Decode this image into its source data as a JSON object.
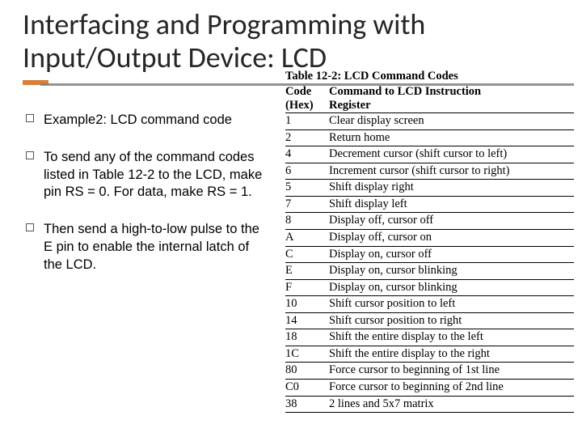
{
  "title": "Interfacing and Programming with Input/Output Device: LCD",
  "bullets": [
    "Example2: LCD command code",
    "To send any of the command codes listed in Table 12-2 to the LCD, make pin RS = 0. For data, make RS = 1.",
    "Then send a high-to-low pulse to the E pin to enable the internal latch of the LCD."
  ],
  "table": {
    "caption": "Table 12-2: LCD Command Codes",
    "head_code": "Code",
    "head_cmd": "Command to LCD Instruction",
    "sub_code": "(Hex)",
    "sub_cmd": "Register",
    "rows": [
      [
        "1",
        "Clear display screen"
      ],
      [
        "2",
        "Return home"
      ],
      [
        "4",
        "Decrement cursor (shift cursor to left)"
      ],
      [
        "6",
        "Increment cursor (shift cursor to right)"
      ],
      [
        "5",
        "Shift display right"
      ],
      [
        "7",
        "Shift display left"
      ],
      [
        "8",
        "Display off, cursor off"
      ],
      [
        "A",
        "Display off, cursor on"
      ],
      [
        "C",
        "Display on, cursor off"
      ],
      [
        "E",
        "Display on, cursor blinking"
      ],
      [
        "F",
        "Display on, cursor blinking"
      ],
      [
        "10",
        "Shift cursor position to left"
      ],
      [
        "14",
        "Shift cursor position to right"
      ],
      [
        "18",
        "Shift the entire display to the left"
      ],
      [
        "1C",
        "Shift the entire display to the right"
      ],
      [
        "80",
        "Force cursor to beginning of 1st line"
      ],
      [
        "C0",
        "Force cursor to beginning of 2nd line"
      ],
      [
        "38",
        "2 lines and 5x7 matrix"
      ]
    ]
  },
  "chart_data": {
    "type": "table",
    "title": "Table 12-2: LCD Command Codes",
    "columns": [
      "Code (Hex)",
      "Command to LCD Instruction Register"
    ],
    "rows": [
      [
        "1",
        "Clear display screen"
      ],
      [
        "2",
        "Return home"
      ],
      [
        "4",
        "Decrement cursor (shift cursor to left)"
      ],
      [
        "6",
        "Increment cursor (shift cursor to right)"
      ],
      [
        "5",
        "Shift display right"
      ],
      [
        "7",
        "Shift display left"
      ],
      [
        "8",
        "Display off, cursor off"
      ],
      [
        "A",
        "Display off, cursor on"
      ],
      [
        "C",
        "Display on, cursor off"
      ],
      [
        "E",
        "Display on, cursor blinking"
      ],
      [
        "F",
        "Display on, cursor blinking"
      ],
      [
        "10",
        "Shift cursor position to left"
      ],
      [
        "14",
        "Shift cursor position to right"
      ],
      [
        "18",
        "Shift the entire display to the left"
      ],
      [
        "1C",
        "Shift the entire display to the right"
      ],
      [
        "80",
        "Force cursor to beginning of 1st line"
      ],
      [
        "C0",
        "Force cursor to beginning of 2nd line"
      ],
      [
        "38",
        "2 lines and 5x7 matrix"
      ]
    ]
  }
}
